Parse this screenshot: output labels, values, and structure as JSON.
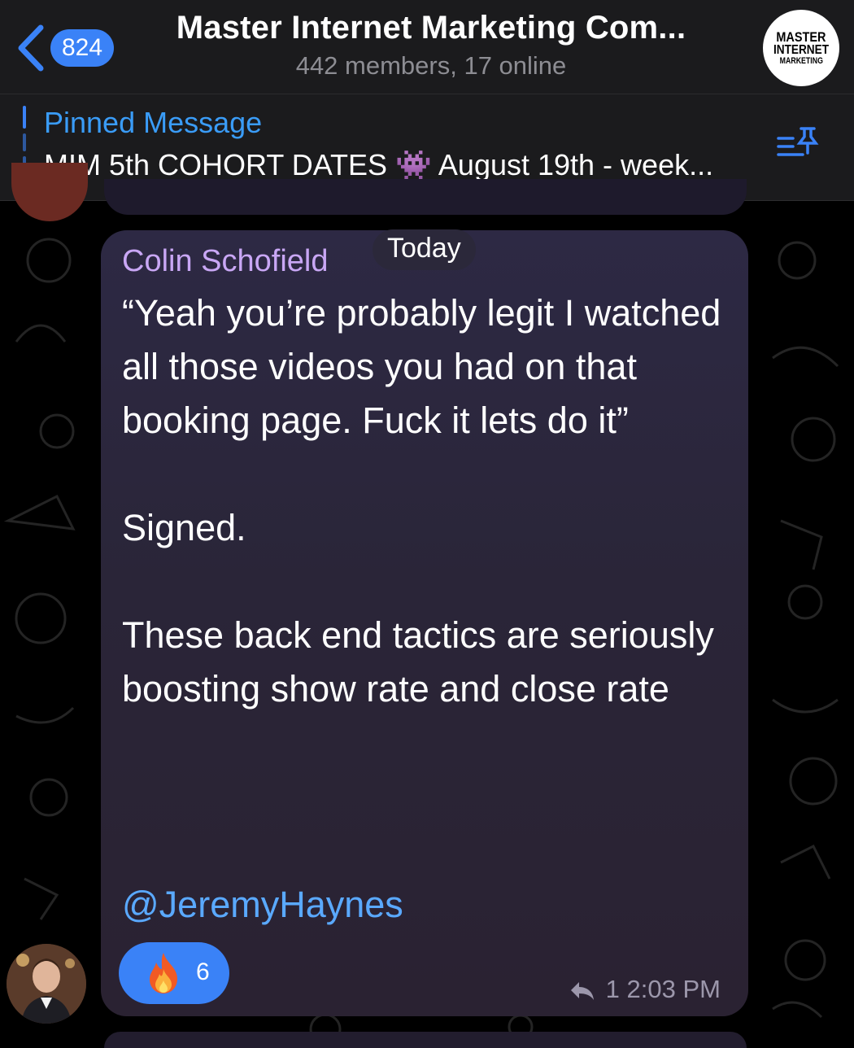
{
  "header": {
    "back_count": "824",
    "title": "Master Internet Marketing Com...",
    "subtitle": "442 members, 17 online",
    "logo_lines": [
      "MASTER",
      "INTERNET",
      "MARKETING"
    ]
  },
  "pinned": {
    "label": "Pinned Message",
    "text": "MIM 5th COHORT DATES 👾 August 19th - week..."
  },
  "message": {
    "date_separator": "Today",
    "sender": "Colin Schofield",
    "body": "“Yeah you’re probably legit I watched all those videos you had on that booking page. Fuck it lets do it”\n\nSigned.\n\nThese back end tactics are seriously boosting show rate and close rate",
    "mention": "@JeremyHaynes",
    "reaction": {
      "emoji": "🔥",
      "count": "6"
    },
    "reply_count": "1",
    "time": "2:03 PM"
  },
  "colors": {
    "accent": "#3a82f7",
    "sender_name": "#c9a7f5",
    "mention": "#5aa9ff",
    "bubble": "#2b2740"
  }
}
